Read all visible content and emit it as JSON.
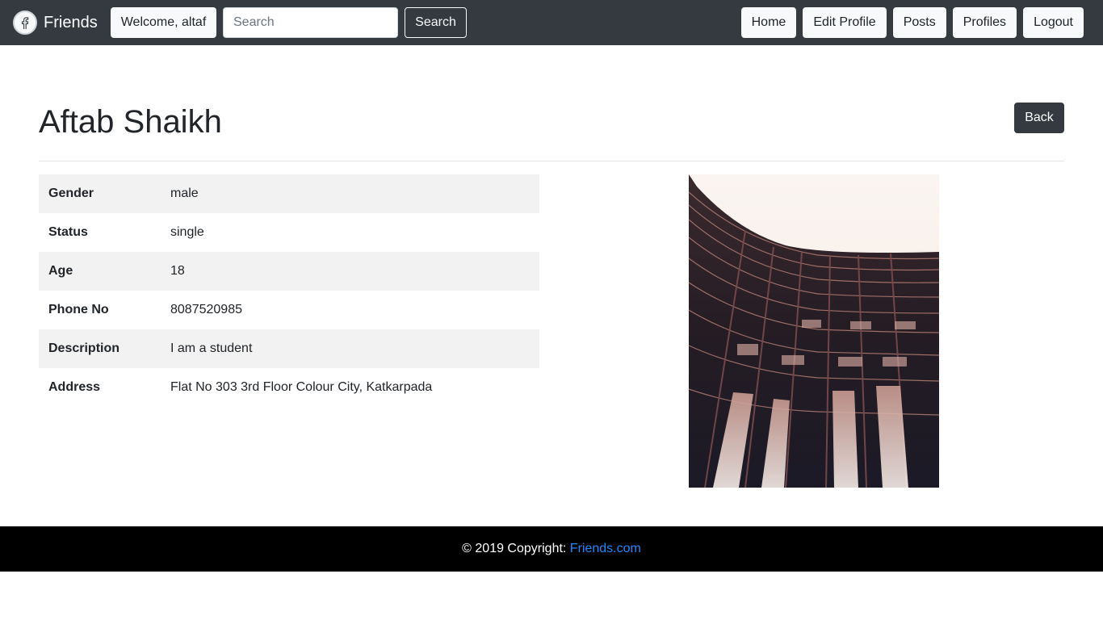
{
  "navbar": {
    "brand_name": "Friends",
    "brand_icon": "facebook-f-icon",
    "welcome_label": "Welcome, altaf",
    "search_placeholder": "Search",
    "search_button_label": "Search",
    "nav_items": [
      {
        "label": "Home"
      },
      {
        "label": "Edit Profile"
      },
      {
        "label": "Posts"
      },
      {
        "label": "Profiles"
      },
      {
        "label": "Logout"
      }
    ]
  },
  "profile": {
    "name": "Aftab Shaikh",
    "back_label": "Back",
    "details": [
      {
        "key": "Gender",
        "value": "male"
      },
      {
        "key": "Status",
        "value": "single"
      },
      {
        "key": "Age",
        "value": "18"
      },
      {
        "key": "Phone No",
        "value": "8087520985"
      },
      {
        "key": "Description",
        "value": "I am a student"
      },
      {
        "key": "Address",
        "value": "Flat No 303 3rd Floor Colour City, Katkarpada"
      }
    ]
  },
  "footer": {
    "copyright_text": "© 2019 Copyright: ",
    "link_text": "Friends.com"
  },
  "colors": {
    "navbar_bg": "#343a40",
    "footer_bg": "#000000",
    "link": "#1e87ff",
    "table_stripe": "#f2f2f2"
  }
}
